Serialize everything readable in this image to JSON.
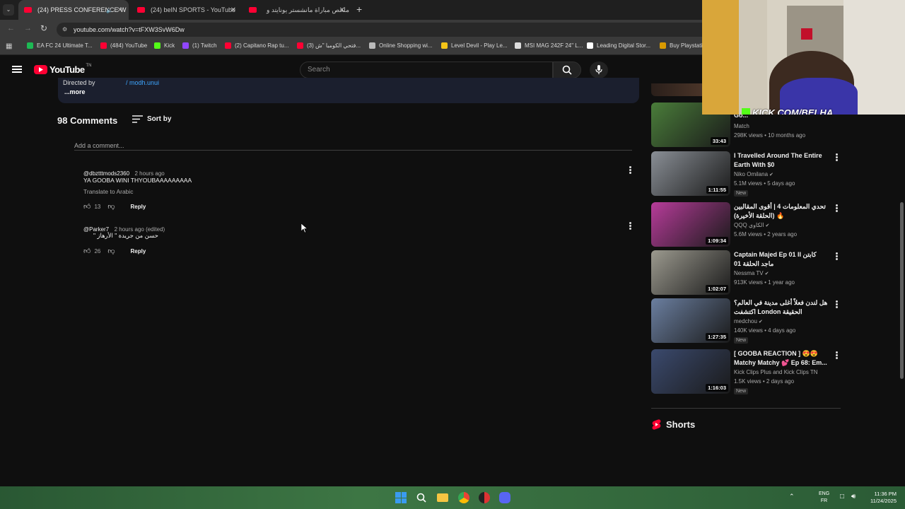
{
  "tabs": [
    {
      "label": "(24) PRESS CONFERENCE W",
      "active": true
    },
    {
      "label": "(24) beIN SPORTS - YouTube",
      "active": false
    },
    {
      "label": "ملخص مباراة مانشستر يونايتد و",
      "active": false
    }
  ],
  "url": "youtube.com/watch?v=tFXW3SvW6Dw",
  "bookmarks": [
    {
      "label": "EA FC 24 Ultimate T...",
      "icon": "ea-icon",
      "color": "#1db954"
    },
    {
      "label": "(484) YouTube",
      "icon": "youtube-icon",
      "color": "#ff0033"
    },
    {
      "label": "Kick",
      "icon": "kick-icon",
      "color": "#53fc18"
    },
    {
      "label": "(1) Twitch",
      "icon": "twitch-icon",
      "color": "#9146ff"
    },
    {
      "label": "(2) Capitano Rap tu...",
      "icon": "youtube-icon",
      "color": "#ff0033"
    },
    {
      "label": "(3) فتحي الكومبا \"ش...",
      "icon": "youtube-icon",
      "color": "#ff0033"
    },
    {
      "label": "Online Shopping wi...",
      "icon": "globe-icon",
      "color": "#bbbbbb"
    },
    {
      "label": "Level Devil - Play Le...",
      "icon": "level-icon",
      "color": "#f5c518"
    },
    {
      "label": "MSI MAG 242F 24\" L...",
      "icon": "msi-icon",
      "color": "#dddddd"
    },
    {
      "label": "Leading Digital Stor...",
      "icon": "store-icon",
      "color": "#ffffff"
    },
    {
      "label": "Buy Playstati...",
      "icon": "folder-icon",
      "color": "#d99a00"
    }
  ],
  "yt": {
    "logo": "YouTube",
    "country": "TN",
    "search_placeholder": "Search"
  },
  "description": {
    "directed": "Directed by",
    "handle": "/ modh.unui",
    "more": "...more"
  },
  "comments_section": {
    "count_label": "98 Comments",
    "sort_label": "Sort by",
    "add_placeholder": "Add a comment..."
  },
  "comments": [
    {
      "handle": "@dbztttmods2360",
      "time": "2 hours ago",
      "text": "YA GOOBA WINI THYOUBAAAAAAAAA",
      "translate": "Translate to Arabic",
      "likes": "13",
      "reply": "Reply"
    },
    {
      "handle": "@Parker7",
      "time": "2 hours ago (edited)",
      "text": "حسن من جريدة \" الأرهاز \"",
      "likes": "26",
      "reply": "Reply"
    }
  ],
  "sidebar": {
    "videos": [
      {
        "title": "Go...",
        "channel": "Match",
        "meta": "298K views • 10 months ago",
        "duration": "33:43",
        "new": false,
        "thumb_color": "#4a7d3a"
      },
      {
        "title": "I Travelled Around The Entire Earth With $0",
        "channel": "Niko Omilana",
        "verified": true,
        "meta": "5.1M views • 5 days ago",
        "duration": "1:11:55",
        "new": true,
        "thumb_color": "#8a8f96"
      },
      {
        "title": "تحدي المعلومات 4 | أقوى المقالبين (الحلقة الأخيرة) 🔥",
        "channel": "QQQ الكاوي",
        "verified": true,
        "meta": "5.6M views • 2 years ago",
        "duration": "1:09:34",
        "new": false,
        "thumb_color": "#b73c9a"
      },
      {
        "title": "Captain Majed Ep 01 II كابتن ماجد الحلقة 01",
        "channel": "Nessma TV",
        "verified": true,
        "meta": "913K views • 1 year ago",
        "duration": "1:02:07",
        "new": false,
        "thumb_color": "#9c9a8f"
      },
      {
        "title": "هل لندن فعلاً أغلى مدينة في العالم؟ اكتشفت London الحقيقة",
        "channel": "medchou",
        "verified": true,
        "meta": "140K views • 4 days ago",
        "duration": "1:27:35",
        "new": true,
        "thumb_color": "#6b7fa0"
      },
      {
        "title": "[ GOOBA REACTION ] 😍😍 Matchy Matchy 💕 Ep 68: Em...",
        "channel": "Kick Clips Plus and Kick Clips TN",
        "verified": false,
        "meta": "1.5K views • 2 days ago",
        "duration": "1:16:03",
        "new": true,
        "thumb_color": "#3b4a6e"
      }
    ],
    "new_label": "New",
    "shorts_label": "Shorts"
  },
  "webcam": {
    "overlay": "KICK.COM/BELHA"
  },
  "taskbar": {
    "lang_top": "ENG",
    "lang_bottom": "FR",
    "time": "11:36 PM",
    "date": "11/24/2025"
  }
}
